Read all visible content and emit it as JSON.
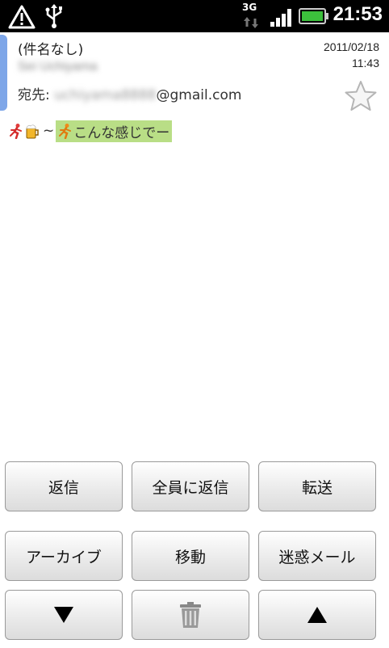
{
  "status_bar": {
    "time": "21:53",
    "network_label": "3G",
    "icons": [
      "warning-icon",
      "usb-icon",
      "data-arrows-icon",
      "signal-bars-icon",
      "battery-icon"
    ]
  },
  "email": {
    "subject": "(件名なし)",
    "from": "Sei Uchiyama",
    "to_label": "宛先:",
    "to_blurred": "uchiyama8888",
    "to_domain": "@gmail.com",
    "date": "2011/02/18",
    "time": "11:43",
    "star_icon": "star-outline-icon",
    "body": {
      "prefix": "~",
      "text": "こんな感じでー",
      "highlight_color": "#b9de86"
    }
  },
  "actions": {
    "reply": "返信",
    "reply_all": "全員に返信",
    "forward": "転送",
    "archive": "アーカイブ",
    "move": "移動",
    "spam": "迷惑メール",
    "prev_icon": "down-arrow-icon",
    "delete_icon": "trash-icon",
    "next_icon": "up-arrow-icon"
  },
  "colors": {
    "accent": "#7ea6e8",
    "highlight": "#b9de86"
  }
}
